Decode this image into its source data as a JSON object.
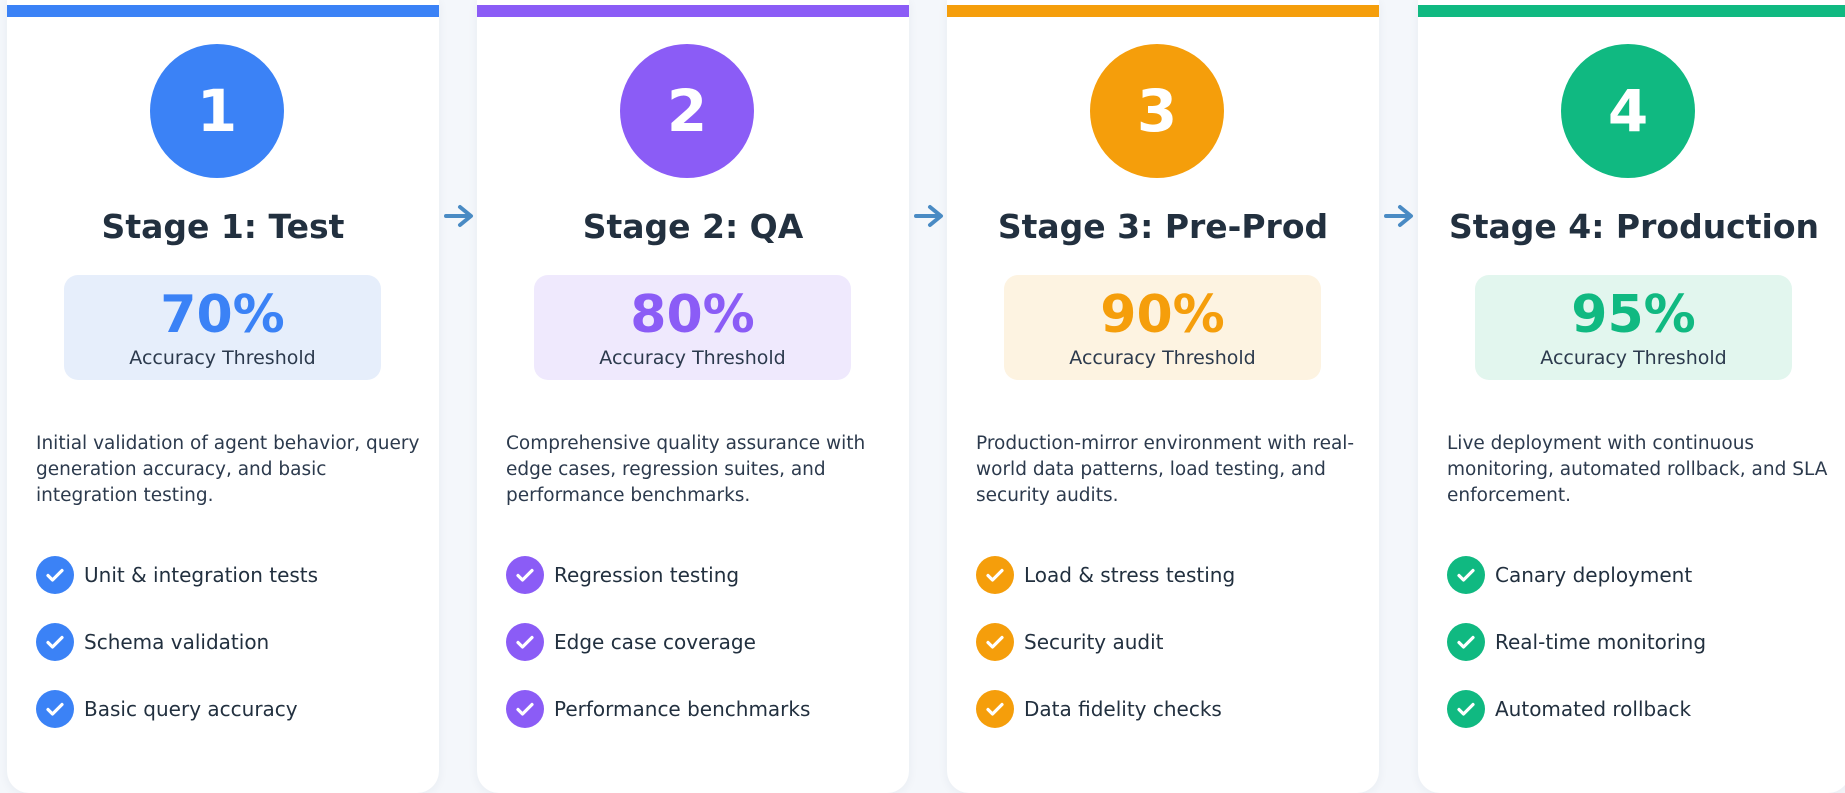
{
  "stages": [
    {
      "number": "1",
      "title": "Stage 1: Test",
      "threshold": "70%",
      "threshold_label": "Accuracy Threshold",
      "description": "Initial validation of agent behavior, query generation accuracy, and basic integration testing.",
      "color": "#3b82f6",
      "tint": "#e6eefb",
      "checks": [
        "Unit & integration tests",
        "Schema validation",
        "Basic query accuracy"
      ]
    },
    {
      "number": "2",
      "title": "Stage 2: QA",
      "threshold": "80%",
      "threshold_label": "Accuracy Threshold",
      "description": "Comprehensive quality assurance with edge cases, regression suites, and performance benchmarks.",
      "color": "#8b5cf6",
      "tint": "#efe9fd",
      "checks": [
        "Regression testing",
        "Edge case coverage",
        "Performance benchmarks"
      ]
    },
    {
      "number": "3",
      "title": "Stage 3: Pre-Prod",
      "threshold": "90%",
      "threshold_label": "Accuracy Threshold",
      "description": "Production-mirror environment with real-world data patterns, load testing, and security audits.",
      "color": "#f59e0b",
      "tint": "#fdf3e1",
      "checks": [
        "Load & stress testing",
        "Security audit",
        "Data fidelity checks"
      ]
    },
    {
      "number": "4",
      "title": "Stage 4: Production",
      "threshold": "95%",
      "threshold_label": "Accuracy Threshold",
      "description": "Live deployment with continuous monitoring, automated rollback, and SLA enforcement.",
      "color": "#10b981",
      "tint": "#e2f6ee",
      "checks": [
        "Canary deployment",
        "Real-time monitoring",
        "Automated rollback"
      ]
    }
  ],
  "icons": {
    "check": "check-icon",
    "connector": "arrow-right-icon"
  },
  "connector_color": "#4a8bc4"
}
